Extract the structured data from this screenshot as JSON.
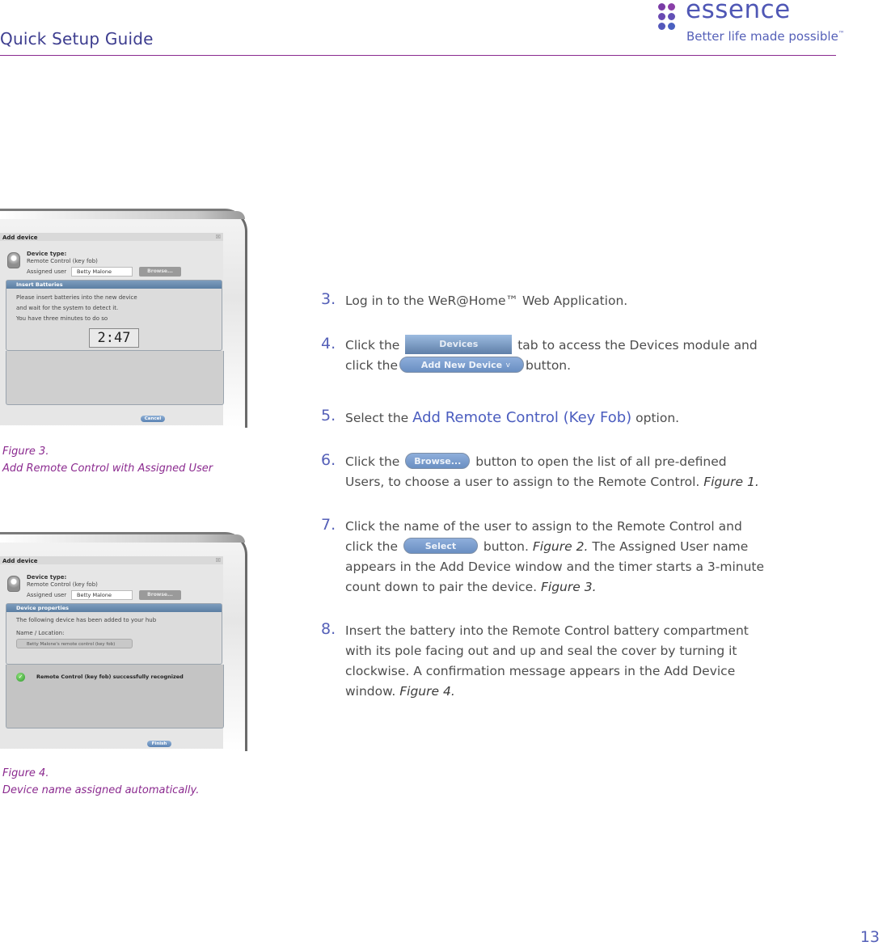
{
  "header": {
    "title": "Quick Setup Guide",
    "logo": {
      "wordmark": "essence",
      "tagline": "Better life made possible",
      "tagline_mark": "™",
      "dot_colors": [
        "#8a3fa8",
        "#7a49b0",
        "#6a52b7",
        "#5a5cbd",
        "#5260c0",
        "#4a66c4"
      ]
    }
  },
  "figures": [
    {
      "caption_line1": "Figure 3.",
      "caption_line2": "Add Remote Control  with Assigned User",
      "dialog": {
        "title": "Add device",
        "close": "☒",
        "device_type_label": "Device type:",
        "device_type_value": "Remote Control (key fob)",
        "assigned_user_label": "Assigned user",
        "assigned_user_value": "Betty Malone",
        "browse_label": "Browse...",
        "panel_title": "Insert Batteries",
        "lines": [
          "Please insert batteries into the new device",
          "and wait for the system to detect it.",
          "You have three minutes to do so"
        ],
        "timer": "2:47",
        "footer_button": "Cancel"
      }
    },
    {
      "caption_line1": "Figure 4.",
      "caption_line2": "Device name assigned automatically.",
      "dialog": {
        "title": "Add device",
        "close": "☒",
        "device_type_label": "Device type:",
        "device_type_value": "Remote Control (key fob)",
        "assigned_user_label": "Assigned user",
        "assigned_user_value": "Betty Malone",
        "browse_label": "Browse...",
        "panel_title": "Device properties",
        "added_text": "The following device has been added to your hub",
        "name_location_label": "Name / Location:",
        "name_location_value": "Betty Malone's remote control (key fob)",
        "success_icon": "✓",
        "success_text": "Remote Control (key fob)  successfully recognized",
        "footer_button": "Finish"
      }
    }
  ],
  "steps": [
    {
      "num": "3.",
      "text": "Log in to the WeR@Home™ Web Application."
    },
    {
      "num": "4.",
      "pre": "Click the",
      "tab_label": "Devices",
      "mid": "tab to access the Devices module and",
      "pre2": "click the",
      "button_label": "Add New Device",
      "button_chevron": "v",
      "post": "button."
    },
    {
      "num": "5.",
      "pre": "Select the",
      "highlight": "Add Remote Control (Key Fob)",
      "post": "option."
    },
    {
      "num": "6.",
      "pre": "Click the",
      "button_label": "Browse...",
      "post": "button to open the list of all pre-defined",
      "line2": "Users, to choose a user to assign to the Remote Control.",
      "ref": "Figure 1."
    },
    {
      "num": "7.",
      "line1": "Click the name of the user to assign to the Remote Control and",
      "pre": "click the",
      "button_label": "Select",
      "post": "button.",
      "ref1": "Figure 2.",
      "post2": "The Assigned User name",
      "line3": "appears in the Add Device window and the timer starts a 3-minute",
      "line4": "count down to pair the device.",
      "ref2": "Figure 3."
    },
    {
      "num": "8.",
      "line1": "Insert the battery into the Remote Control battery compartment",
      "line2": "with its pole facing out and up and seal the cover by turning it",
      "line3": "clockwise. A confirmation message appears in the Add Device",
      "line4": "window.",
      "ref": "Figure 4."
    }
  ],
  "page_number": "13"
}
